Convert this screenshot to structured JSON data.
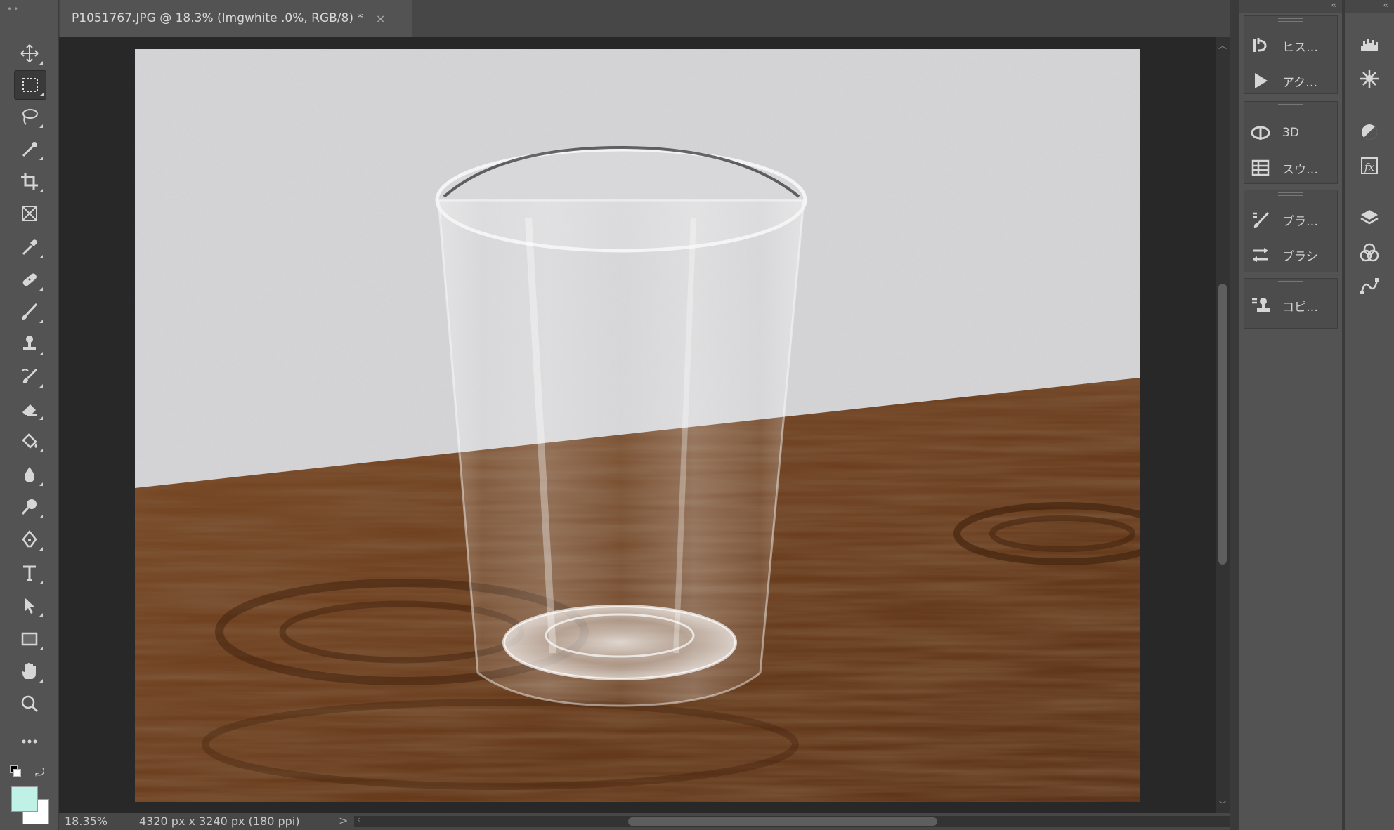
{
  "document": {
    "tab_title": "P1051767.JPG @ 18.3% (Imgwhite .0%, RGB/8) *",
    "close_glyph": "×"
  },
  "status": {
    "zoom": "18.35%",
    "dimensions": "4320 px x 3240 px (180 ppi)",
    "arrow": ">"
  },
  "tools": [
    {
      "name": "move-tool",
      "icon": "move-icon"
    },
    {
      "name": "rectangular-marquee-tool",
      "icon": "marquee-icon",
      "active": true
    },
    {
      "name": "lasso-tool",
      "icon": "lasso-icon"
    },
    {
      "name": "quick-selection-tool",
      "icon": "quick-select-icon"
    },
    {
      "name": "crop-tool",
      "icon": "crop-icon"
    },
    {
      "name": "frame-tool",
      "icon": "frame-icon"
    },
    {
      "name": "eyedropper-tool",
      "icon": "eyedropper-icon"
    },
    {
      "name": "healing-brush-tool",
      "icon": "bandage-icon"
    },
    {
      "name": "brush-tool",
      "icon": "brush-icon"
    },
    {
      "name": "clone-stamp-tool",
      "icon": "stamp-icon"
    },
    {
      "name": "history-brush-tool",
      "icon": "history-brush-icon"
    },
    {
      "name": "eraser-tool",
      "icon": "eraser-icon"
    },
    {
      "name": "paint-bucket-tool",
      "icon": "paint-bucket-icon"
    },
    {
      "name": "blur-tool",
      "icon": "drop-icon"
    },
    {
      "name": "dodge-tool",
      "icon": "dodge-icon"
    },
    {
      "name": "pen-tool",
      "icon": "pen-icon"
    },
    {
      "name": "type-tool",
      "icon": "type-icon"
    },
    {
      "name": "path-selection-tool",
      "icon": "arrow-icon"
    },
    {
      "name": "rectangle-tool",
      "icon": "rectangle-icon"
    },
    {
      "name": "hand-tool",
      "icon": "hand-icon"
    },
    {
      "name": "zoom-tool",
      "icon": "zoom-icon"
    },
    {
      "name": "edit-toolbar",
      "icon": "more-icon"
    }
  ],
  "swatches": {
    "foreground": "#bff1e6",
    "background": "#ffffff",
    "swap_glyph": "⤾"
  },
  "panels": {
    "group1": [
      {
        "label": "ヒス…",
        "icon": "history-icon"
      },
      {
        "label": "アク…",
        "icon": "play-icon"
      }
    ],
    "group2": [
      {
        "label": "3D",
        "icon": "3d-icon"
      },
      {
        "label": "スウ…",
        "icon": "swatches-grid-icon"
      }
    ],
    "group3": [
      {
        "label": "ブラ…",
        "icon": "brush-settings-icon"
      },
      {
        "label": "ブラシ",
        "icon": "brushes-icon"
      }
    ],
    "group4": [
      {
        "label": "コピ…",
        "icon": "clone-source-icon"
      }
    ],
    "right_icons": [
      "histogram-icon",
      "navigator-icon",
      "adjustments-icon",
      "styles-icon",
      "layers-icon",
      "channels-icon",
      "paths-icon"
    ]
  },
  "colors": {
    "ui_bg": "#535353",
    "workspace_bg": "#282828",
    "panel_text": "#d0d0d0"
  }
}
